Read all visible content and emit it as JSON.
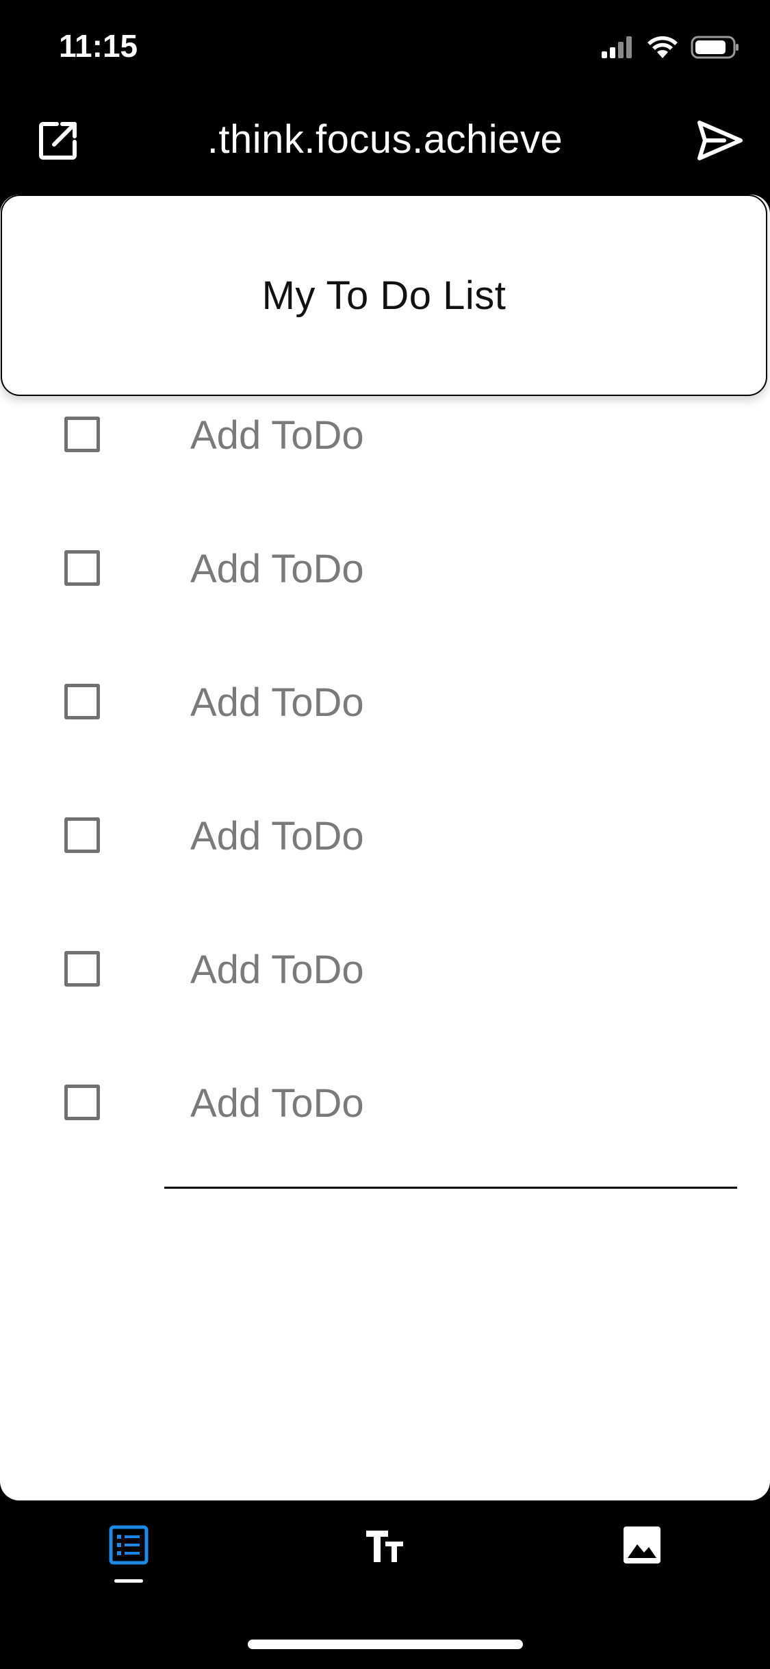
{
  "status_bar": {
    "time": "11:15",
    "icons": [
      "cellular-signal-icon",
      "wifi-icon",
      "battery-icon"
    ]
  },
  "top_bar": {
    "title": ".think.focus.achieve",
    "left_icon": "open-external-icon",
    "right_icon": "send-icon"
  },
  "list": {
    "title": "My To Do List",
    "items": [
      {
        "checked": false,
        "value": "",
        "placeholder": "Add ToDo"
      },
      {
        "checked": false,
        "value": "",
        "placeholder": "Add ToDo"
      },
      {
        "checked": false,
        "value": "",
        "placeholder": "Add ToDo"
      },
      {
        "checked": false,
        "value": "",
        "placeholder": "Add ToDo"
      },
      {
        "checked": false,
        "value": "",
        "placeholder": "Add ToDo"
      },
      {
        "checked": false,
        "value": "",
        "placeholder": "Add ToDo"
      }
    ]
  },
  "tabs": [
    {
      "icon": "checklist-icon",
      "active": true
    },
    {
      "icon": "text-format-icon",
      "active": false
    },
    {
      "icon": "image-icon",
      "active": false
    }
  ],
  "colors": {
    "background": "#000000",
    "card": "#ffffff",
    "accent": "#1e88e5",
    "placeholder": "#7a7a7a",
    "checkbox_border": "#707070"
  }
}
